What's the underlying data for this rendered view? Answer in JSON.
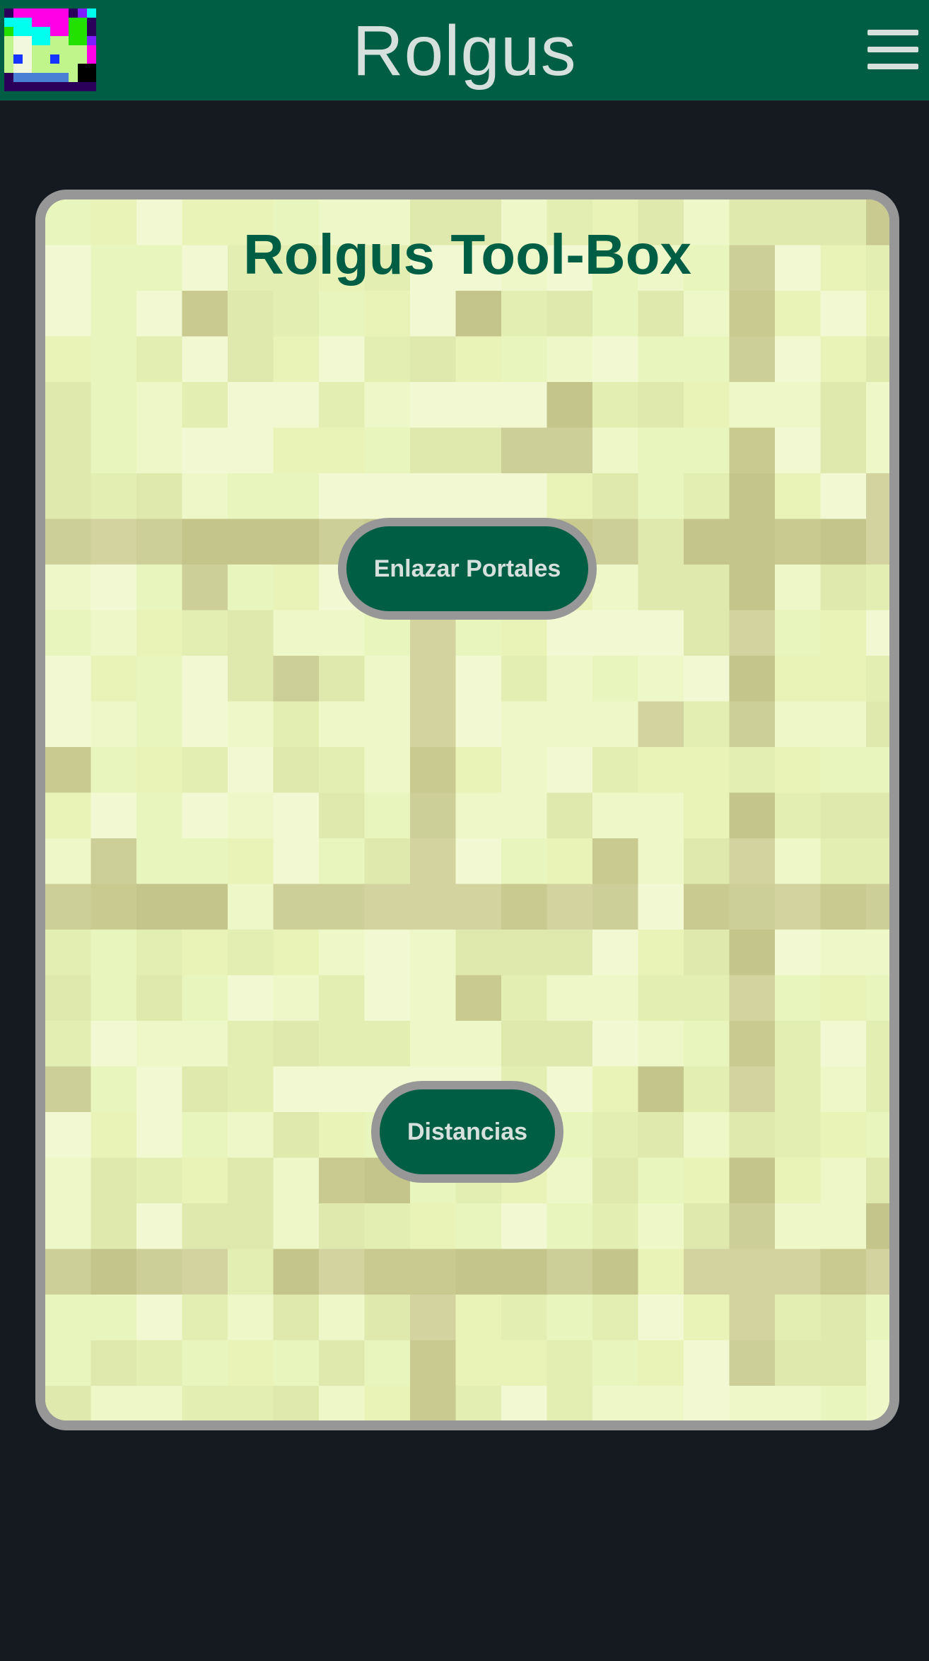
{
  "header": {
    "title": "Rolgus",
    "logo_icon": "pixel-avatar-icon",
    "menu_icon": "hamburger-menu-icon",
    "background_color": "#005e45",
    "text_color": "#d6e0dc"
  },
  "main": {
    "card_title": "Rolgus Tool-Box",
    "card_background": "pixel-grass-tile-pattern",
    "buttons": [
      {
        "label": "Enlazar Portales"
      },
      {
        "label": "Distancias"
      }
    ]
  },
  "colors": {
    "page_background": "#141a20",
    "accent": "#005e45",
    "button_border": "#979797",
    "button_text": "#d6e0dc"
  }
}
